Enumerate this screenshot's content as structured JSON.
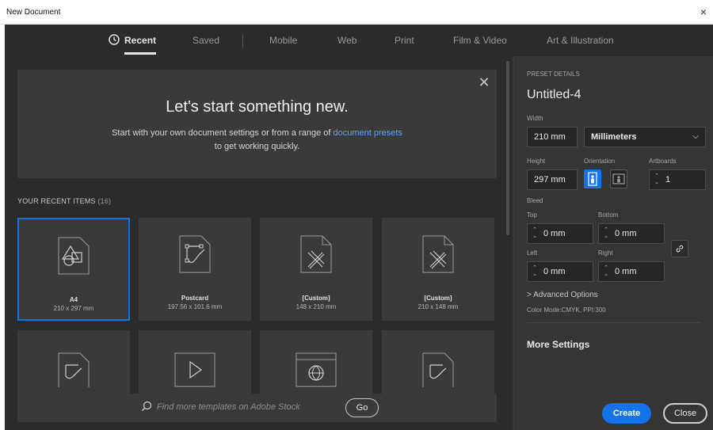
{
  "window": {
    "title": "New Document",
    "close_symbol": "×"
  },
  "tabs": [
    {
      "label": "Recent",
      "active": true
    },
    {
      "label": "Saved"
    },
    {
      "label": "Mobile"
    },
    {
      "label": "Web"
    },
    {
      "label": "Print"
    },
    {
      "label": "Film & Video"
    },
    {
      "label": "Art & Illustration"
    }
  ],
  "welcome": {
    "title": "Let's start something new.",
    "text_before": "Start with your own document settings or from a range of ",
    "link": "document presets",
    "text_after": "to get working quickly.",
    "close_symbol": "✕"
  },
  "recent": {
    "label": "YOUR RECENT ITEMS",
    "count": "(16)",
    "items": [
      {
        "name": "A4",
        "size": "210 x 297 mm",
        "icon": "shapes-icon",
        "selected": true
      },
      {
        "name": "Postcard",
        "size": "197.56 x 101.6 mm",
        "icon": "pen-path-icon"
      },
      {
        "name": "[Custom]",
        "size": "148 x 210 mm",
        "icon": "ruler-pencil-icon"
      },
      {
        "name": "[Custom]",
        "size": "210 x 148 mm",
        "icon": "ruler-pencil-icon"
      }
    ],
    "row2_icons": [
      "pen-path-icon",
      "play-icon",
      "globe-web-icon",
      "pen-path-icon"
    ]
  },
  "stock": {
    "placeholder": "Find more templates on Adobe Stock",
    "go_label": "Go"
  },
  "preset": {
    "section_label": "PRESET DETAILS",
    "name": "Untitled-4",
    "width_label": "Width",
    "width_value": "210 mm",
    "unit": "Millimeters",
    "height_label": "Height",
    "height_value": "297 mm",
    "orientation_label": "Orientation",
    "artboards_label": "Artboards",
    "artboards_value": "1",
    "bleed_label": "Bleed",
    "top_label": "Top",
    "top_value": "0 mm",
    "bottom_label": "Bottom",
    "bottom_value": "0 mm",
    "left_label": "Left",
    "left_value": "0 mm",
    "right_label": "Right",
    "right_value": "0 mm",
    "advanced_label": "> Advanced Options",
    "color_mode": "Color Mode:CMYK, PPI:300",
    "more_settings": "More Settings"
  },
  "actions": {
    "create": "Create",
    "close": "Close"
  },
  "colors": {
    "accent": "#1473e6",
    "panel": "#313131",
    "field": "#262626"
  }
}
